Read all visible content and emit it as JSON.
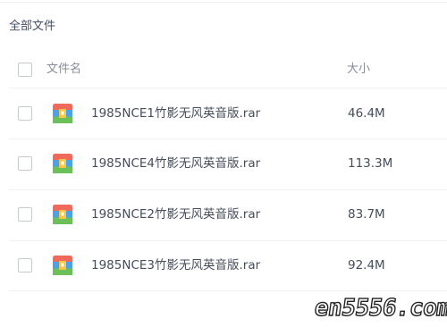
{
  "breadcrumb": {
    "label": "全部文件"
  },
  "list_header": {
    "name_label": "文件名",
    "size_label": "大小"
  },
  "files": [
    {
      "name": "1985NCE1竹影无风英音版.rar",
      "size": "46.4M",
      "icon": "archive-rar-icon"
    },
    {
      "name": "1985NCE4竹影无风英音版.rar",
      "size": "113.3M",
      "icon": "archive-rar-icon"
    },
    {
      "name": "1985NCE2竹影无风英音版.rar",
      "size": "83.7M",
      "icon": "archive-rar-icon"
    },
    {
      "name": "1985NCE3竹影无风英音版.rar",
      "size": "92.4M",
      "icon": "archive-rar-icon"
    }
  ],
  "watermark": {
    "text": "en5556.com"
  },
  "colors": {
    "icon_red": "#f06a5c",
    "icon_blue": "#4aa3e8",
    "icon_green": "#6dbf5a",
    "icon_yellow": "#f7c744"
  }
}
